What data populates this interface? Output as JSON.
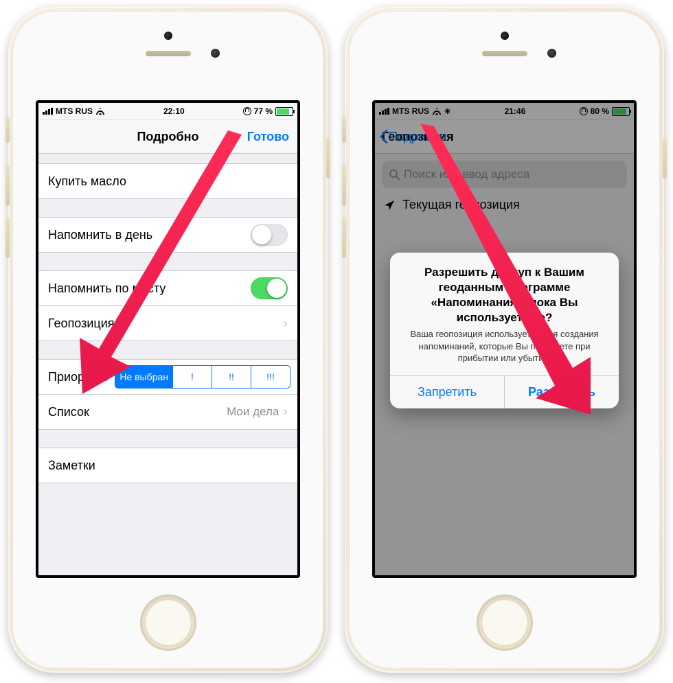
{
  "left": {
    "status": {
      "carrier": "MTS RUS",
      "time": "22:10",
      "battery_pct": "77 %",
      "battery_fill": 77
    },
    "nav": {
      "title": "Подробно",
      "done": "Готово"
    },
    "task_title": "Купить масло",
    "remind_day": {
      "label": "Напомнить в день",
      "on": false
    },
    "remind_place": {
      "label": "Напомнить по месту",
      "on": true
    },
    "location": {
      "label": "Геопозиция"
    },
    "priority": {
      "label": "Приоритет",
      "options": [
        "Не выбран",
        "!",
        "!!",
        "!!!"
      ],
      "selected": 0
    },
    "list": {
      "label": "Список",
      "value": "Мои дела"
    },
    "notes": {
      "label": "Заметки"
    }
  },
  "right": {
    "status": {
      "carrier": "MTS RUS",
      "time": "21:46",
      "battery_pct": "80 %",
      "battery_fill": 80
    },
    "nav": {
      "back": "Подробно",
      "title": "Геопозиция"
    },
    "search_placeholder": "Поиск или ввод адреса",
    "current_location": "Текущая геопозиция",
    "alert": {
      "title": "Разрешить доступ к Вашим геоданным программе «Напоминания», пока Вы используете ее?",
      "message": "Ваша геопозиция используется для создания напоминаний, которые Вы получаете при прибытии или убытии.",
      "deny": "Запретить",
      "allow": "Разрешить"
    }
  }
}
